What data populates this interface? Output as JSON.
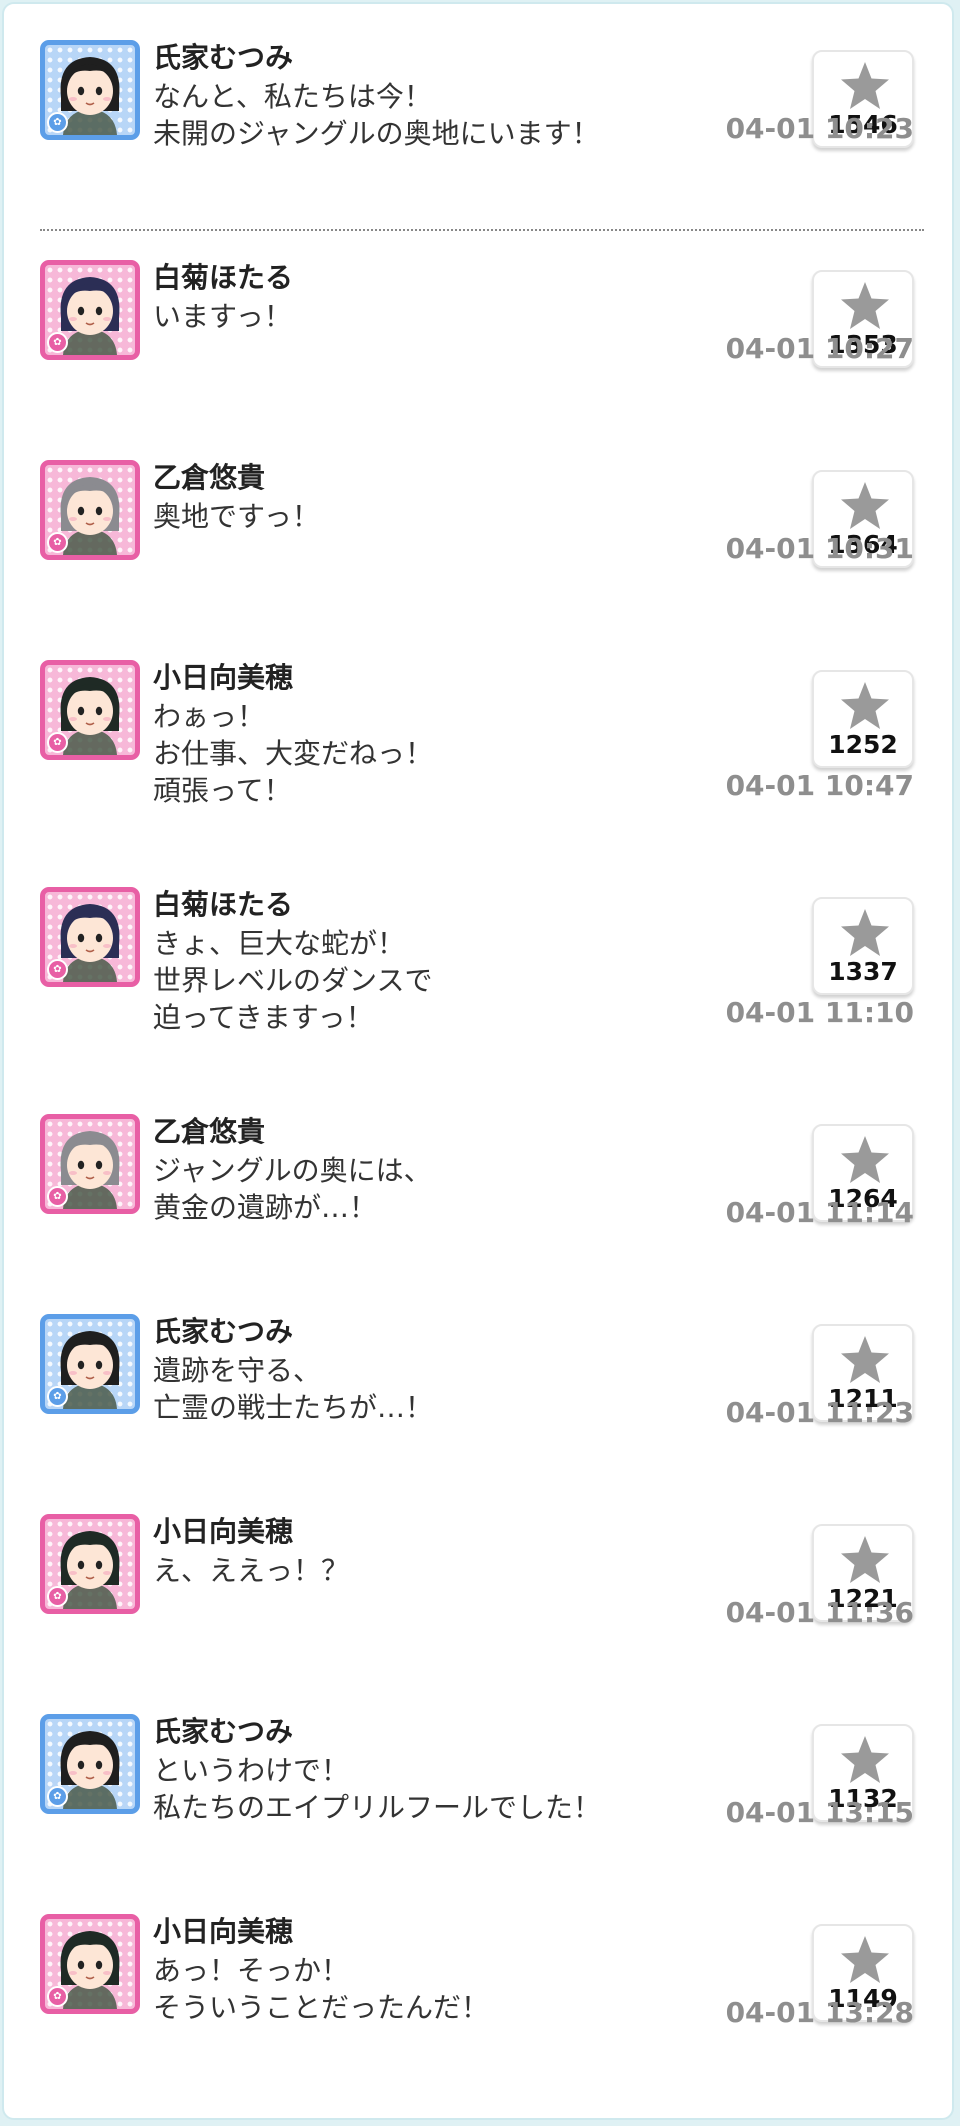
{
  "posts": [
    {
      "name": "氏家むつみ",
      "lines": [
        "なんと、私たちは今！",
        "未開のジャングルの奥地にいます！"
      ],
      "likes": "1546",
      "time": "04-01 10:23",
      "avatar": "blue",
      "hair": "#1f1f1f"
    },
    {
      "name": "白菊ほたる",
      "lines": [
        "いますっ！"
      ],
      "likes": "1353",
      "time": "04-01 10:27",
      "avatar": "pink",
      "hair": "#2b2e55"
    },
    {
      "name": "乙倉悠貴",
      "lines": [
        "奥地ですっ！"
      ],
      "likes": "1364",
      "time": "04-01 10:31",
      "avatar": "pink",
      "hair": "#8b8b90"
    },
    {
      "name": "小日向美穂",
      "lines": [
        "わぁっ！",
        "お仕事、大変だねっ！",
        "頑張って！"
      ],
      "likes": "1252",
      "time": "04-01 10:47",
      "avatar": "pink",
      "hair": "#1f2a25"
    },
    {
      "name": "白菊ほたる",
      "lines": [
        "きょ、巨大な蛇が！",
        "世界レベルのダンスで",
        "迫ってきますっ！"
      ],
      "likes": "1337",
      "time": "04-01 11:10",
      "avatar": "pink",
      "hair": "#2b2e55"
    },
    {
      "name": "乙倉悠貴",
      "lines": [
        "ジャングルの奥には、",
        "黄金の遺跡が…！"
      ],
      "likes": "1264",
      "time": "04-01 11:14",
      "avatar": "pink",
      "hair": "#8b8b90"
    },
    {
      "name": "氏家むつみ",
      "lines": [
        "遺跡を守る、",
        "亡霊の戦士たちが…！"
      ],
      "likes": "1211",
      "time": "04-01 11:23",
      "avatar": "blue",
      "hair": "#1f1f1f"
    },
    {
      "name": "小日向美穂",
      "lines": [
        "え、ええっ！？"
      ],
      "likes": "1221",
      "time": "04-01 11:36",
      "avatar": "pink",
      "hair": "#1f2a25"
    },
    {
      "name": "氏家むつみ",
      "lines": [
        "というわけで！",
        "私たちのエイプリルフールでした！"
      ],
      "likes": "1132",
      "time": "04-01 13:15",
      "avatar": "blue",
      "hair": "#1f1f1f"
    },
    {
      "name": "小日向美穂",
      "lines": [
        "あっ！そっか！",
        "そういうことだったんだ！"
      ],
      "likes": "1149",
      "time": "04-01 13:28",
      "avatar": "pink",
      "hair": "#1f2a25"
    }
  ]
}
